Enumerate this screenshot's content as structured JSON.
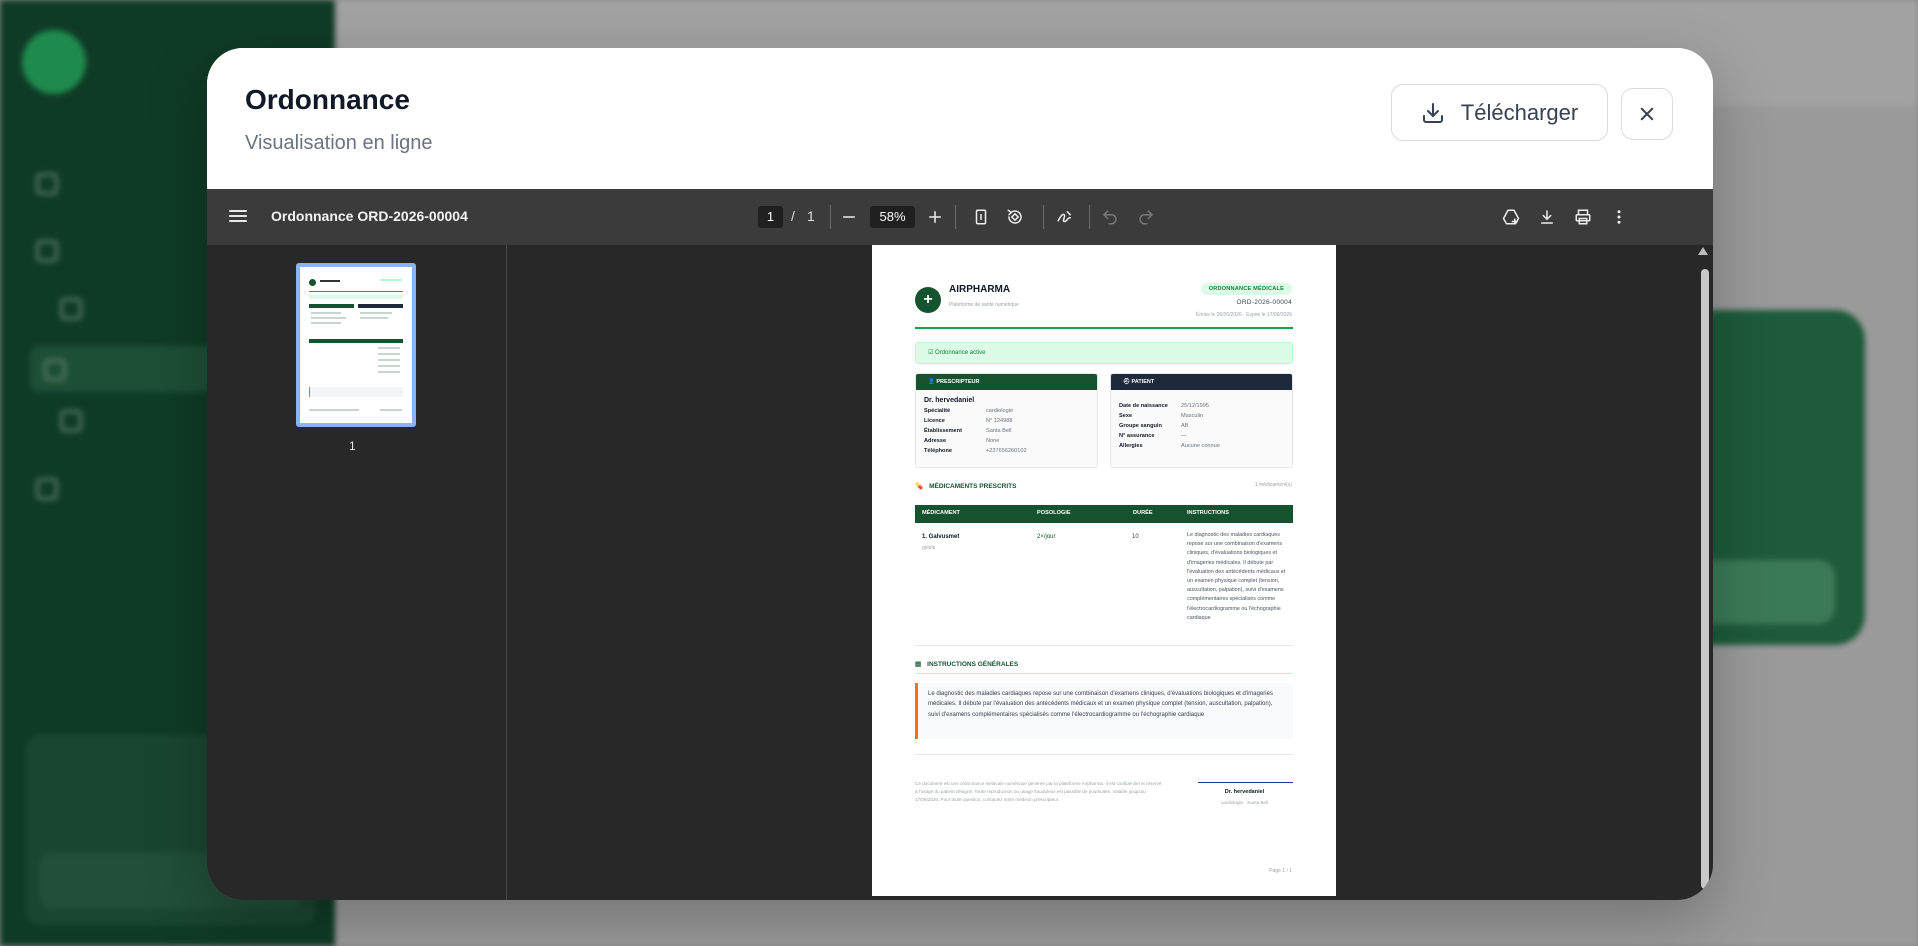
{
  "modal": {
    "title": "Ordonnance",
    "subtitle": "Visualisation en ligne",
    "download_label": "Télécharger"
  },
  "viewer": {
    "document_title": "Ordonnance ORD-2026-00004",
    "current_page": "1",
    "page_separator": "/",
    "total_pages": "1",
    "zoom": "58%",
    "thumbnail_label": "1"
  },
  "document": {
    "brand": "AIRPHARMA",
    "brand_sub": "Plateforme de santé numérique",
    "badge": "ORDONNANCE MÉDICALE",
    "reference": "ORD-2026-00004",
    "dates": "Émise le 26/05/2026 · Expire le 17/06/2026",
    "status": "Ordonnance active",
    "prescriber": {
      "header": "PRESCRIPTEUR",
      "name": "Dr. hervedaniel",
      "rows": [
        {
          "k": "Spécialité",
          "v": "cardiologie"
        },
        {
          "k": "Licence",
          "v": "N° 124988"
        },
        {
          "k": "Établissement",
          "v": "Santa Bell"
        },
        {
          "k": "Adresse",
          "v": "None"
        },
        {
          "k": "Téléphone",
          "v": "+237656260102"
        }
      ]
    },
    "patient": {
      "header": "PATIENT",
      "rows": [
        {
          "k": "Date de naissance",
          "v": "25/12/1995"
        },
        {
          "k": "Sexe",
          "v": "Masculin"
        },
        {
          "k": "Groupe sanguin",
          "v": "AB"
        },
        {
          "k": "N° assurance",
          "v": "—"
        },
        {
          "k": "Allergies",
          "v": "Aucune connue"
        }
      ]
    },
    "meds_title": "MÉDICAMENTS PRESCRITS",
    "meds_count": "1 médicament(s)",
    "table_headers": [
      "MÉDICAMENT",
      "POSOLOGIE",
      "DURÉE",
      "INSTRUCTIONS"
    ],
    "medication": {
      "name": "1. Galvusmet",
      "form": "gelule",
      "dosage": "2×/jour",
      "duration": "10",
      "instructions": "Le diagnostic des maladies cardiaques repose sur une combinaison d'examens cliniques, d'évaluations biologiques et d'imageries médicales. Il débute par l'évaluation des antécédents médicaux et un examen physique complet (tension, auscultation, palpation), suivi d'examens complémentaires spécialisés comme l'électrocardiogramme ou l'échographie cardiaque"
    },
    "general_title": "INSTRUCTIONS GÉNÉRALES",
    "general_text": "Le diagnostic des maladies cardiaques repose sur une combinaison d'examens cliniques, d'évaluations biologiques et d'imageries médicales. Il débute par l'évaluation des antécédents médicaux et un examen physique complet (tension, auscultation, palpation), suivi d'examens complémentaires spécialisés comme l'électrocardiogramme ou l'échographie cardiaque",
    "footer": "Ce document est une ordonnance médicale numérique générée par la plateforme Airpharma. Il est confidentiel et réservé à l'usage du patient désigné. Toute reproduction ou usage frauduleux est passible de poursuites. Valable jusqu'au 17/06/2026. Pour toute question, contactez votre médecin prescripteur.",
    "signature_name": "Dr. hervedaniel",
    "signature_sub": "cardiologie · Santa Bell",
    "page_number": "Page 1 / 1"
  },
  "colors": {
    "brand_green": "#14532d",
    "accent_green": "#16a34a",
    "patient_header": "#1e293b",
    "note_accent": "#f97316",
    "viewer_toolbar": "#3b3b3b",
    "viewer_bg": "#282828"
  }
}
